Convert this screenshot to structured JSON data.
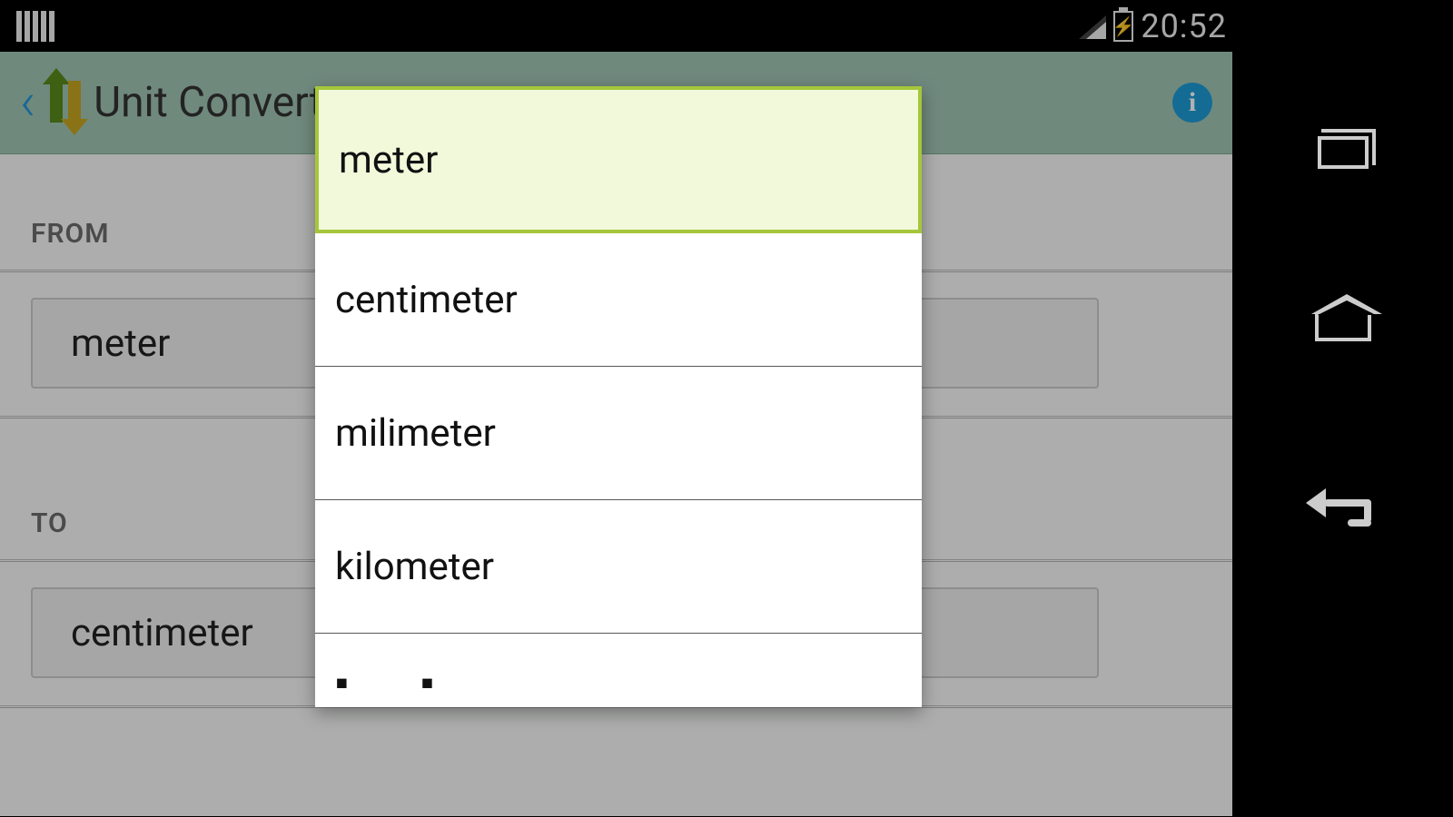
{
  "statusbar": {
    "time": "20:52"
  },
  "actionbar": {
    "title": "Unit Converter"
  },
  "labels": {
    "from": "FROM",
    "to": "TO"
  },
  "fields": {
    "from_value": "meter",
    "to_value": "centimeter"
  },
  "dialog": {
    "options": [
      "meter",
      "centimeter",
      "milimeter",
      "kilometer"
    ],
    "partial": ". . ."
  }
}
